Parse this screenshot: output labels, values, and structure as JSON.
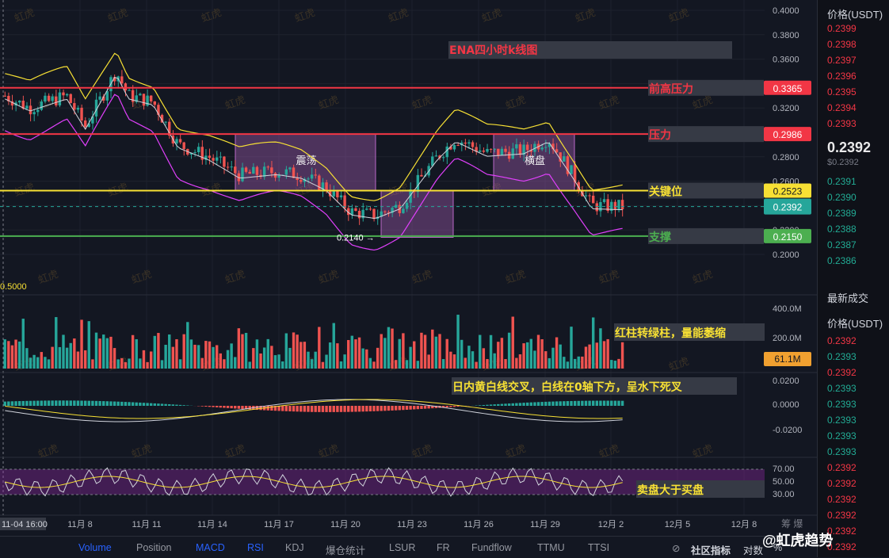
{
  "chart_data": {
    "type": "candlestick",
    "title": "ENA四小时k线图",
    "x_ticks": [
      "11月 8",
      "11月 11",
      "11月 14",
      "11月 17",
      "11月 20",
      "11月 23",
      "11月 26",
      "11月 29",
      "12月 2",
      "12月 5",
      "12月 8"
    ],
    "x_first_label": "11-04 16:00",
    "y_ticks": [
      "0.4000",
      "0.3800",
      "0.3600",
      "0.3400",
      "0.3200",
      "0.3000",
      "0.2800",
      "0.2600",
      "0.2400",
      "0.2200",
      "0.2000"
    ],
    "ylim": [
      0.19,
      0.402
    ],
    "last_price": 0.2392,
    "levels": [
      {
        "label": "前高压力",
        "value": "0.3365",
        "color": "#f23645"
      },
      {
        "label": "压力",
        "value": "0.2986",
        "color": "#f23645"
      },
      {
        "label": "关键位",
        "value": "0.2523",
        "color": "#f7e034"
      },
      {
        "label": "支撑",
        "value": "0.2150",
        "color": "#4caf50"
      }
    ],
    "current_price_tag": "0.2392",
    "low_marker": "0.2140",
    "fib_label": "0.5000",
    "boxes": [
      {
        "label": "震荡",
        "x0": 0.34,
        "x1": 0.56,
        "y_top": 0.2986,
        "y_bottom": 0.2523
      },
      {
        "label": "",
        "x0": 0.56,
        "x1": 0.66,
        "y_top": 0.2523,
        "y_bottom": 0.214
      },
      {
        "label": "横盘",
        "x0": 0.72,
        "x1": 0.86,
        "y_top": 0.2986,
        "y_bottom": 0.2523
      }
    ],
    "volume": {
      "ticks": [
        "400.0M",
        "200.0M"
      ],
      "last": "61.1M",
      "note": "红柱转绿柱，量能萎缩"
    },
    "macd": {
      "ticks": [
        "0.0200",
        "0.0000",
        "-0.0200"
      ],
      "note": "日内黄白线交叉，白线在0轴下方，呈水下死叉"
    },
    "rsi": {
      "ticks": [
        "70.00",
        "50.00",
        "30.00"
      ],
      "note": "卖盘大于买盘"
    },
    "watermark": "虹虎"
  },
  "sidebar": {
    "header1": "价格(USDT)",
    "asks": [
      "0.2399",
      "0.2398",
      "0.2397",
      "0.2396",
      "0.2395",
      "0.2394",
      "0.2393"
    ],
    "price": "0.2392",
    "price_sub": "$0.2392",
    "bids": [
      "0.2391",
      "0.2390",
      "0.2389",
      "0.2388",
      "0.2387",
      "0.2386"
    ],
    "header2": "最新成交",
    "header3": "价格(USDT)",
    "trades": [
      {
        "p": "0.2392",
        "c": "red"
      },
      {
        "p": "0.2393",
        "c": "green"
      },
      {
        "p": "0.2392",
        "c": "red"
      },
      {
        "p": "0.2393",
        "c": "green"
      },
      {
        "p": "0.2393",
        "c": "green"
      },
      {
        "p": "0.2393",
        "c": "green"
      },
      {
        "p": "0.2393",
        "c": "green"
      },
      {
        "p": "0.2393",
        "c": "green"
      },
      {
        "p": "0.2392",
        "c": "red"
      },
      {
        "p": "0.2392",
        "c": "red"
      },
      {
        "p": "0.2392",
        "c": "red"
      },
      {
        "p": "0.2392",
        "c": "red"
      },
      {
        "p": "0.2392",
        "c": "red"
      },
      {
        "p": "0.2392",
        "c": "red"
      }
    ]
  },
  "bottom_tabs": [
    {
      "label": "Volume",
      "active": true
    },
    {
      "label": "Position",
      "active": false
    },
    {
      "label": "MACD",
      "active": true
    },
    {
      "label": "RSI",
      "active": true
    },
    {
      "label": "KDJ",
      "active": false
    },
    {
      "label": "爆仓统计",
      "active": false
    },
    {
      "label": "LSUR",
      "active": false
    },
    {
      "label": "FR",
      "active": false
    },
    {
      "label": "Fundflow",
      "active": false
    },
    {
      "label": "TTMU",
      "active": false
    },
    {
      "label": "TTSI",
      "active": false
    }
  ],
  "community": "社区指标",
  "compare": "对数",
  "percent": "%",
  "right_icons": "筹 爆",
  "brand": "@虹虎趋势"
}
